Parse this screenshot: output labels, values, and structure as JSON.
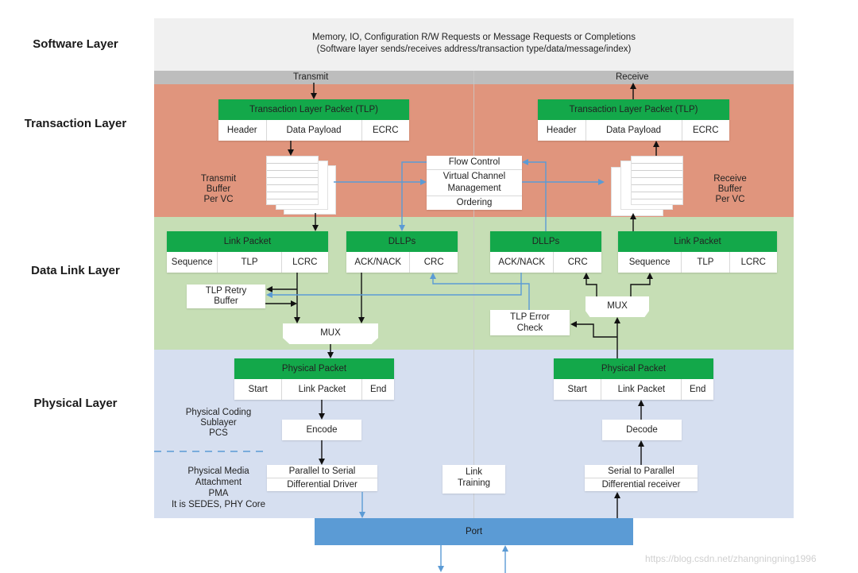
{
  "layers": {
    "software": "Software Layer",
    "transaction": "Transaction Layer",
    "data_link": "Data Link Layer",
    "physical": "Physical Layer"
  },
  "software_band": {
    "line1": "Memory, IO, Configuration R/W Requests or Message Requests or Completions",
    "line2": "(Software layer sends/receives address/transaction type/data/message/index)"
  },
  "direction": {
    "transmit": "Transmit",
    "receive": "Receive"
  },
  "transaction_layer": {
    "tx_tlp": {
      "title": "Transaction Layer Packet (TLP)",
      "fields": [
        "Header",
        "Data Payload",
        "ECRC"
      ]
    },
    "rx_tlp": {
      "title": "Transaction Layer Packet (TLP)",
      "fields": [
        "Header",
        "Data Payload",
        "ECRC"
      ]
    },
    "tx_buffer_label": [
      "Transmit",
      "Buffer",
      "Per VC"
    ],
    "rx_buffer_label": [
      "Receive",
      "Buffer",
      "Per VC"
    ],
    "control_box": [
      "Flow Control",
      "Virtual Channel Management",
      "Ordering"
    ]
  },
  "data_link_layer": {
    "tx_link_packet": {
      "title": "Link Packet",
      "fields": [
        "Sequence",
        "TLP",
        "LCRC"
      ]
    },
    "tx_dllps": {
      "title": "DLLPs",
      "fields": [
        "ACK/NACK",
        "CRC"
      ]
    },
    "rx_dllps": {
      "title": "DLLPs",
      "fields": [
        "ACK/NACK",
        "CRC"
      ]
    },
    "rx_link_packet": {
      "title": "Link Packet",
      "fields": [
        "Sequence",
        "TLP",
        "LCRC"
      ]
    },
    "retry_buffer": [
      "TLP Retry",
      "Buffer"
    ],
    "error_check": [
      "TLP Error",
      "Check"
    ],
    "tx_mux": "MUX",
    "rx_mux": "MUX"
  },
  "physical_layer": {
    "tx_packet": {
      "title": "Physical Packet",
      "fields": [
        "Start",
        "Link Packet",
        "End"
      ]
    },
    "rx_packet": {
      "title": "Physical Packet",
      "fields": [
        "Start",
        "Link Packet",
        "End"
      ]
    },
    "pcs_label": [
      "Physical Coding",
      "Sublayer",
      "PCS"
    ],
    "pma_label": [
      "Physical Media",
      "Attachment",
      "PMA",
      "It is SEDES, PHY Core"
    ],
    "encode": "Encode",
    "decode": "Decode",
    "tx_driver": [
      "Parallel to Serial",
      "Differential Driver"
    ],
    "rx_receiver": [
      "Serial to Parallel",
      "Differential receiver"
    ],
    "link_training": [
      "Link",
      "Training"
    ]
  },
  "port": "Port",
  "watermark": "https://blog.csdn.net/zhangningning1996",
  "colors": {
    "software_bg": "#f0f0f0",
    "direction_bar": "#bdbdbd",
    "transaction_bg": "#e0957d",
    "data_link_bg": "#c6deb5",
    "physical_bg": "#d6dff0",
    "packet_header": "#13a84a",
    "port": "#5b9bd5",
    "control_arrow": "#5b9bd5"
  }
}
